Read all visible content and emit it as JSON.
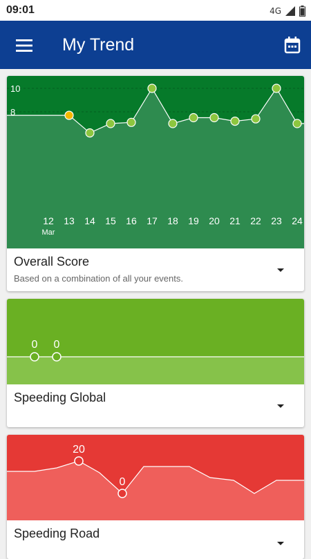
{
  "status_bar": {
    "time": "09:01",
    "network": "4G"
  },
  "app_bar": {
    "title": "My Trend",
    "menu_icon": "menu-icon",
    "calendar_icon": "calendar-icon"
  },
  "colors": {
    "app_bar": "#0d3f92",
    "overall_bg": "#067a2a",
    "overall_fill": "#2e8b4f",
    "global_bg": "#6ab023",
    "global_fill": "#86c24a",
    "road_bg": "#e53935",
    "road_fill": "#ef5f5b",
    "point_green": "#8dc63f",
    "point_highlight": "#f5b800"
  },
  "cards": [
    {
      "title": "Overall Score",
      "subtitle": "Based on a combination of all your events.",
      "chart_data": {
        "type": "area",
        "x": [
          "12",
          "13",
          "14",
          "15",
          "16",
          "17",
          "18",
          "19",
          "20",
          "21",
          "22",
          "23",
          "24"
        ],
        "x_month_label": "Mar",
        "y": [
          null,
          7.7,
          6.2,
          7.0,
          7.1,
          10.0,
          7.0,
          7.5,
          7.5,
          7.2,
          7.4,
          10.0,
          7.0
        ],
        "y_ticks": [
          "0",
          "2",
          "4",
          "6",
          "8",
          "10"
        ],
        "ylim": [
          0,
          10
        ],
        "highlighted_point": "13",
        "grid": true
      }
    },
    {
      "title": "Speeding Global",
      "subtitle": "",
      "chart_data": {
        "type": "area",
        "points": [
          {
            "label": "0",
            "value": 0
          },
          {
            "label": "0",
            "value": 0
          }
        ]
      }
    },
    {
      "title": "Speeding Road",
      "subtitle": "",
      "chart_data": {
        "type": "area",
        "point_labels": [
          "20",
          "0"
        ]
      }
    }
  ]
}
